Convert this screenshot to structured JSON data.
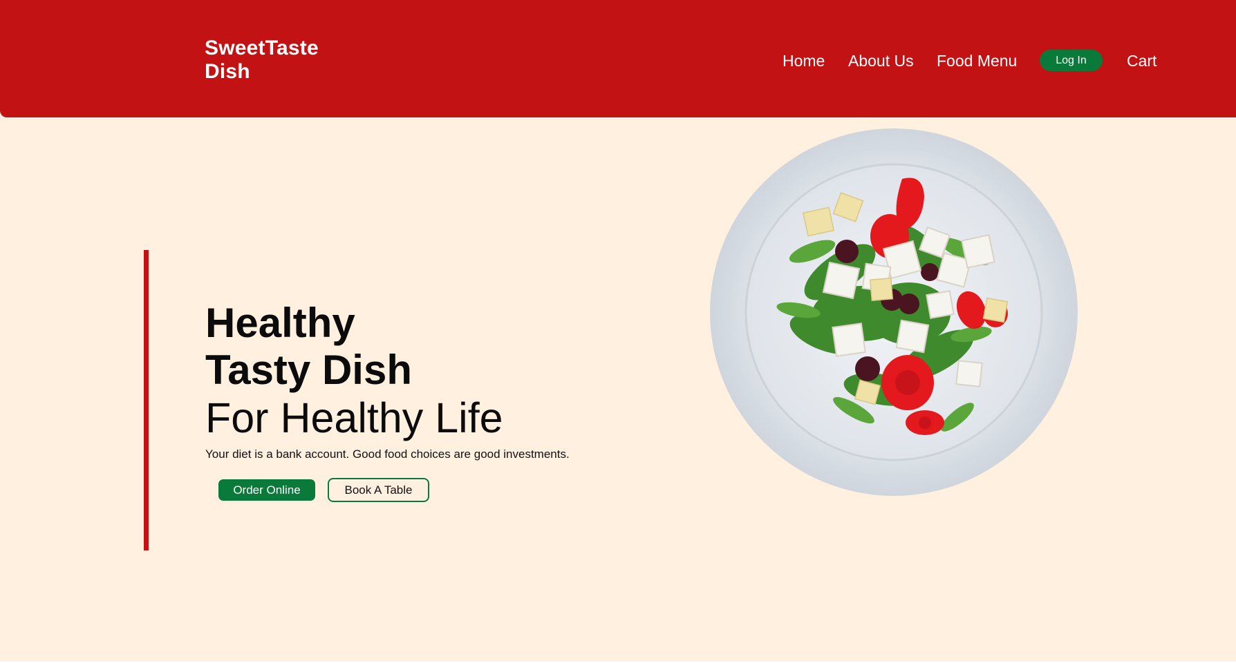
{
  "header": {
    "brand_line1": "SweetTaste",
    "brand_line2": "Dish",
    "nav": {
      "home": "Home",
      "about": "About Us",
      "menu": "Food Menu",
      "login": "Log In",
      "cart": "Cart"
    }
  },
  "hero": {
    "line1": "Healthy",
    "line2": "Tasty Dish",
    "line3": "For Healthy Life",
    "tagline": "Your diet is a bank account. Good food choices are good investments.",
    "order_button": "Order Online",
    "book_button": "Book A Table"
  },
  "colors": {
    "header_red": "#c31214",
    "accent_green": "#0a7a3a",
    "background_cream": "#fff0df"
  },
  "images": {
    "hero_image": "salad-plate"
  }
}
